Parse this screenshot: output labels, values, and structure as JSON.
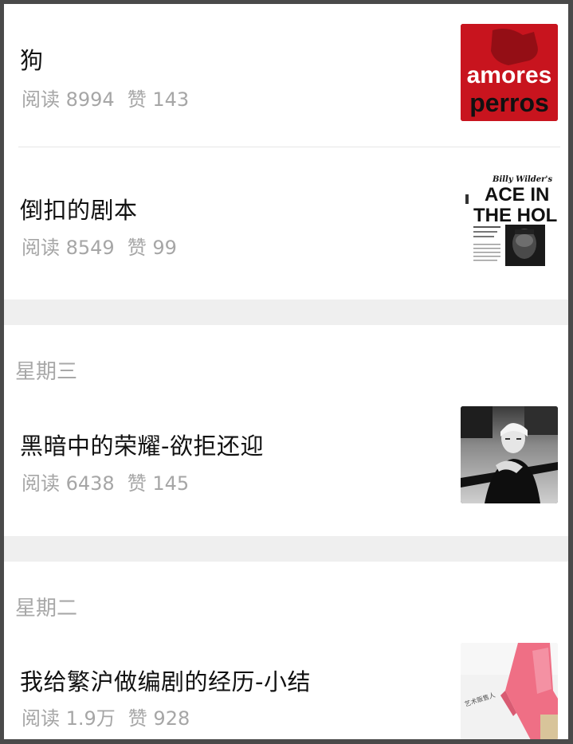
{
  "articles": [
    {
      "title": "狗",
      "reads": "阅读 8994",
      "likes": "赞 143",
      "thumb": "amores-perros-poster"
    },
    {
      "title": "倒扣的剧本",
      "reads": "阅读 8549",
      "likes": "赞 99",
      "thumb": "ace-in-the-hole-poster"
    },
    {
      "title": "黑暗中的荣耀-欲拒还迎",
      "reads": "阅读 6438",
      "likes": "赞 145",
      "thumb": "black-white-film-still"
    },
    {
      "title": "我给繁沪做编剧的经历-小结",
      "reads": "阅读 1.9万",
      "likes": "赞 928",
      "thumb": "pink-object-photo"
    }
  ],
  "days": [
    "星期三",
    "星期二"
  ],
  "posters": {
    "amores_top": "amores",
    "amores_bottom": "perros",
    "ace_credit": "Billy Wilder's",
    "ace_line1": "ACE IN",
    "ace_line2": "THE HOLE",
    "pink_caption": "艺术贩售人"
  },
  "colors": {
    "title": "#111111",
    "meta": "#a6a6a6",
    "section_gap": "#efefef",
    "frame": "#4a4a4a",
    "amores_red": "#c8141e"
  }
}
